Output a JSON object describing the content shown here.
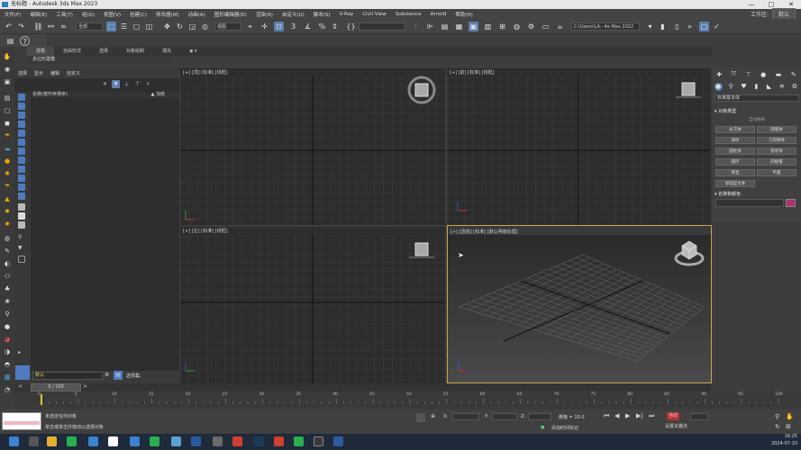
{
  "window": {
    "title": "无标题 - Autodesk 3ds Max 2023",
    "controls": [
      "—",
      "□",
      "✕"
    ]
  },
  "menu": {
    "items": [
      "文件(F)",
      "编辑(E)",
      "工具(T)",
      "组(G)",
      "视图(V)",
      "创建(C)",
      "修改器(M)",
      "动画(A)",
      "图形编辑器(D)",
      "渲染(R)",
      "自定义(U)",
      "脚本(S)",
      "V-Ray",
      "Civil View",
      "Substance",
      "Arnold",
      "帮助(H)"
    ],
    "workspace_label": "工作区:",
    "workspace_value": "默认"
  },
  "toolbar": {
    "selection_filter": "全部",
    "ref_coord": "视图",
    "named_sel": "",
    "path_field": "C:\\Users\\LA···4e Max 2022"
  },
  "ribbon": {
    "tabs": [
      "建模",
      "自由形式",
      "选择",
      "对象绘制",
      "填充"
    ],
    "sub_label": "多边形建模"
  },
  "scene_explorer": {
    "menu": [
      "选择",
      "显示",
      "编辑",
      "自定义"
    ],
    "col_name": "名称(按升序排序)",
    "col_frozen": "▲ 冻结"
  },
  "viewports": {
    "top": "[+] [顶] [标准] [线框]",
    "front": "[+] [前] [标准] [线框]",
    "left": "[+] [左] [标准] [线框]",
    "persp": "[+] [透视] [标准] [默认明暗处理]"
  },
  "command_panel": {
    "dropdown": "标准基本体",
    "object_type_header": "▾ 对象类型",
    "autogrid": "自动栅格",
    "buttons": [
      "长方体",
      "圆锥体",
      "球体",
      "几何球体",
      "圆柱体",
      "管状体",
      "圆环",
      "四棱锥",
      "茶壶",
      "平面",
      "加强型文本",
      ""
    ],
    "name_color_header": "▾ 名称和颜色",
    "swatch_color": "#b0306f"
  },
  "layer_bar": {
    "layer_value": "默认",
    "select_set_label": "选择集:"
  },
  "timeline": {
    "frame_counter": "0 / 100",
    "ticks": [
      "0",
      "5",
      "10",
      "15",
      "20",
      "25",
      "30",
      "35",
      "40",
      "45",
      "50",
      "55",
      "60",
      "65",
      "70",
      "75",
      "80",
      "85",
      "90",
      "95",
      "100"
    ]
  },
  "status": {
    "maxscript_hint": "",
    "line1": "未选定任何对象",
    "line2": "单击或单击并拖动以选择对象",
    "grid_label": "栅格 = 10.0",
    "add_time_tag": "添加时间标记",
    "x_label": "X:",
    "y_label": "Y:",
    "z_label": "Z:",
    "autokey": "自动",
    "set_key": "设置关键点"
  },
  "taskbar": {
    "time": "16:25",
    "date": "2024-07-10"
  }
}
